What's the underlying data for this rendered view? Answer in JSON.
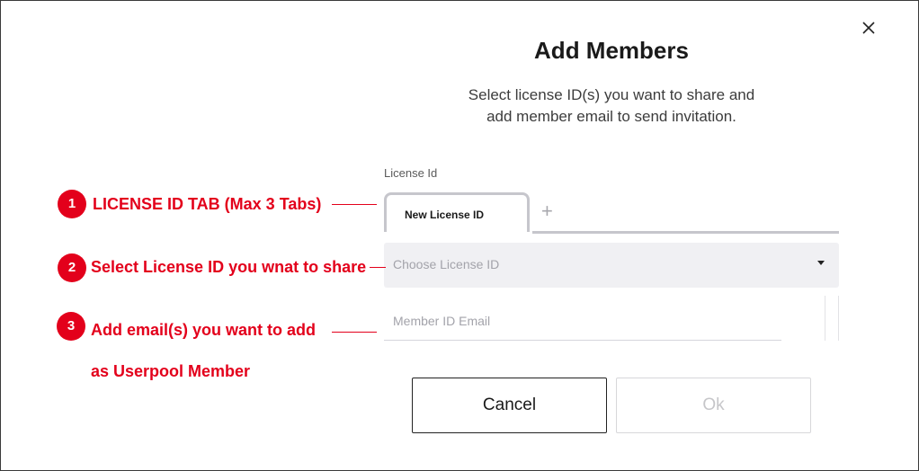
{
  "dialog": {
    "title": "Add Members",
    "subtitle_line1": "Select license ID(s) you want to share and",
    "subtitle_line2": "add member email to send invitation.",
    "close_icon": "close-icon"
  },
  "license": {
    "label": "License Id",
    "tabs": [
      {
        "label": "New License ID",
        "active": true
      }
    ],
    "add_tab_symbol": "+",
    "select_placeholder": "Choose License ID"
  },
  "email": {
    "placeholder": "Member ID Email"
  },
  "buttons": {
    "cancel": "Cancel",
    "ok": "Ok"
  },
  "annotations": [
    {
      "number": "1",
      "text": "LICENSE ID TAB (Max 3 Tabs)"
    },
    {
      "number": "2",
      "text": "Select License ID you wnat to share"
    },
    {
      "number": "3",
      "text": "Add email(s) you want to add",
      "text_line2": "as Userpool Member"
    }
  ],
  "colors": {
    "annotation_red": "#e3001b",
    "tab_border": "#c6c6cc",
    "select_bg": "#f0f0f3"
  }
}
